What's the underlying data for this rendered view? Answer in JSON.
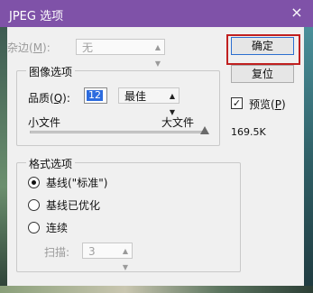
{
  "window": {
    "title": "JPEG 选项",
    "close_icon": "×"
  },
  "matte": {
    "label": "杂边(M):",
    "label_plain": "杂边(",
    "hotkey": "M",
    "label_end": "):",
    "value": "无"
  },
  "image_options": {
    "legend": "图像选项",
    "quality_label_plain": "品质(",
    "quality_hotkey": "Q",
    "quality_label_end": "):",
    "quality_value": "12",
    "quality_preset": "最佳",
    "small_file": "小文件",
    "large_file": "大文件",
    "slider_fraction": 1.0
  },
  "format_options": {
    "legend": "格式选项",
    "options": [
      {
        "label": "基线(\"标准\")",
        "selected": true
      },
      {
        "label": "基线已优化",
        "selected": false
      },
      {
        "label": "连续",
        "selected": false
      }
    ],
    "scans_label": "扫描:",
    "scans_value": "3"
  },
  "buttons": {
    "ok": "确定",
    "reset": "复位"
  },
  "preview": {
    "label_plain": "预览(",
    "hotkey": "P",
    "label_end": ")",
    "checked": true
  },
  "file_size": "169.5K"
}
